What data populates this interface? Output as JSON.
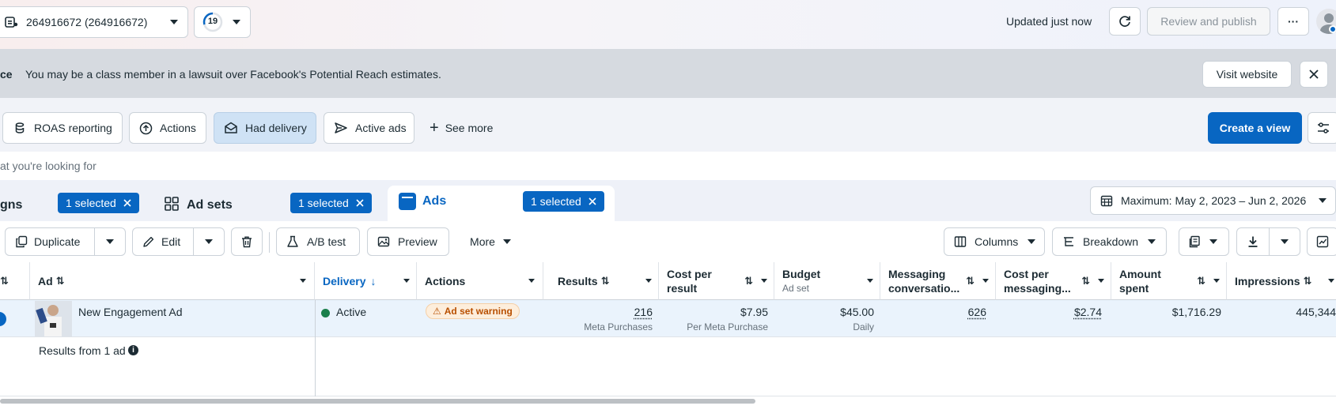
{
  "topbar": {
    "account_label": "264916672 (264916672)",
    "notifications_count": "19",
    "updated_text": "Updated just now",
    "review_publish_label": "Review and publish",
    "more_label": "···"
  },
  "notice": {
    "prefix": "ce",
    "message": "You may be a class member in a lawsuit over Facebook's Potential Reach estimates.",
    "visit_label": "Visit website"
  },
  "views": {
    "items": [
      {
        "label": "ROAS reporting"
      },
      {
        "label": "Actions"
      },
      {
        "label": "Had delivery"
      },
      {
        "label": "Active ads"
      }
    ],
    "see_more_label": "See more",
    "create_view_label": "Create a view"
  },
  "search": {
    "placeholder_text": "at you're looking for"
  },
  "levels": {
    "campaigns_label": "gns",
    "campaigns_selected": "1 selected",
    "adsets_label": "Ad sets",
    "adsets_selected": "1 selected",
    "ads_label": "Ads",
    "ads_selected": "1 selected",
    "date_range": "Maximum: May 2, 2023 – Jun 2, 2026"
  },
  "toolbar": {
    "duplicate_label": "Duplicate",
    "edit_label": "Edit",
    "ab_test_label": "A/B test",
    "preview_label": "Preview",
    "more_label": "More",
    "columns_label": "Columns",
    "breakdown_label": "Breakdown"
  },
  "table": {
    "headers": {
      "ad": "Ad",
      "delivery": "Delivery",
      "actions": "Actions",
      "results": "Results",
      "cost_per_result_1": "Cost per",
      "cost_per_result_2": "result",
      "budget": "Budget",
      "budget_sub": "Ad set",
      "messaging_1": "Messaging",
      "messaging_2": "conversatio...",
      "cost_messaging_1": "Cost per",
      "cost_messaging_2": "messaging...",
      "amount_1": "Amount",
      "amount_2": "spent",
      "impressions": "Impressions"
    },
    "row": {
      "ad_name": "New Engagement Ad",
      "delivery": "Active",
      "actions_warning": "Ad set warning",
      "results": "216",
      "results_sub": "Meta Purchases",
      "cost_per_result": "$7.95",
      "cost_per_result_sub": "Per Meta Purchase",
      "budget": "$45.00",
      "budget_sub": "Daily",
      "messaging": "626",
      "cost_messaging": "$2.74",
      "amount_spent": "$1,716.29",
      "impressions": "445,344"
    },
    "footer": "Results from 1 ad"
  },
  "colors": {
    "brand_blue": "#0866c2",
    "active_green": "#1a7f4b",
    "warning_orange": "#b84f00"
  }
}
